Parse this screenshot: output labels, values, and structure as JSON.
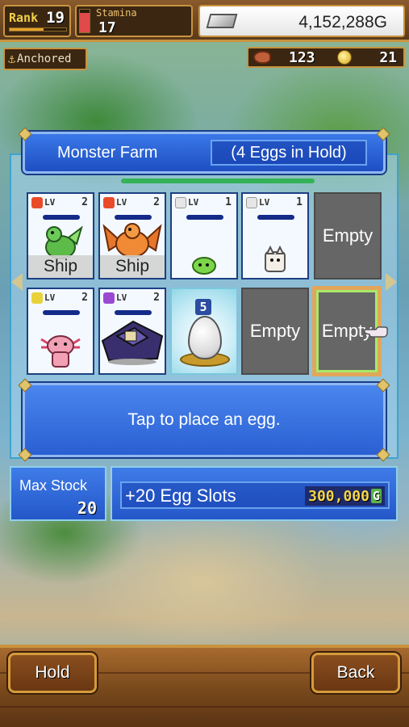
{
  "hud": {
    "rank_label": "Rank",
    "rank_value": "19",
    "rank_progress": 0.6,
    "stamina_label": "Stamina",
    "stamina_value": "17",
    "stamina_level": 0.85,
    "gold_value": "4,152,288G",
    "status_label": "Anchored",
    "food_value": "123",
    "medal_value": "21"
  },
  "farm": {
    "title": "Monster Farm",
    "eggs_in_hold": "(4 Eggs in Hold)",
    "message": "Tap to place an egg.",
    "slots": [
      {
        "type": "monster",
        "element": "fire",
        "lv_label": "LV",
        "level": "2",
        "creature": "green-dragon",
        "tag": "Ship"
      },
      {
        "type": "monster",
        "element": "fire",
        "lv_label": "LV",
        "level": "2",
        "creature": "orange-dragon",
        "tag": "Ship"
      },
      {
        "type": "monster",
        "element": "neutral",
        "lv_label": "LV",
        "level": "1",
        "creature": "green-slime",
        "tag": ""
      },
      {
        "type": "monster",
        "element": "neutral",
        "lv_label": "LV",
        "level": "1",
        "creature": "white-cat",
        "tag": ""
      },
      {
        "type": "empty",
        "label": "Empty"
      },
      {
        "type": "monster",
        "element": "thunder",
        "lv_label": "LV",
        "level": "2",
        "creature": "pink-axolotl",
        "tag": ""
      },
      {
        "type": "monster",
        "element": "dark",
        "lv_label": "LV",
        "level": "2",
        "creature": "dark-knight",
        "tag": ""
      },
      {
        "type": "egg",
        "egg_number": "5"
      },
      {
        "type": "empty",
        "label": "Empty"
      },
      {
        "type": "empty",
        "label": "Empty",
        "selected": true
      }
    ]
  },
  "stock": {
    "label": "Max Stock",
    "value": "20"
  },
  "upgrade": {
    "label": "+20 Egg Slots",
    "price": "300,000",
    "currency": "G"
  },
  "buttons": {
    "hold": "Hold",
    "back": "Back"
  },
  "colors": {
    "panel_blue": "#2a5fd2",
    "wood": "#7a4a1c",
    "gold_trim": "#c9933f",
    "price_yellow": "#f5d54a"
  }
}
